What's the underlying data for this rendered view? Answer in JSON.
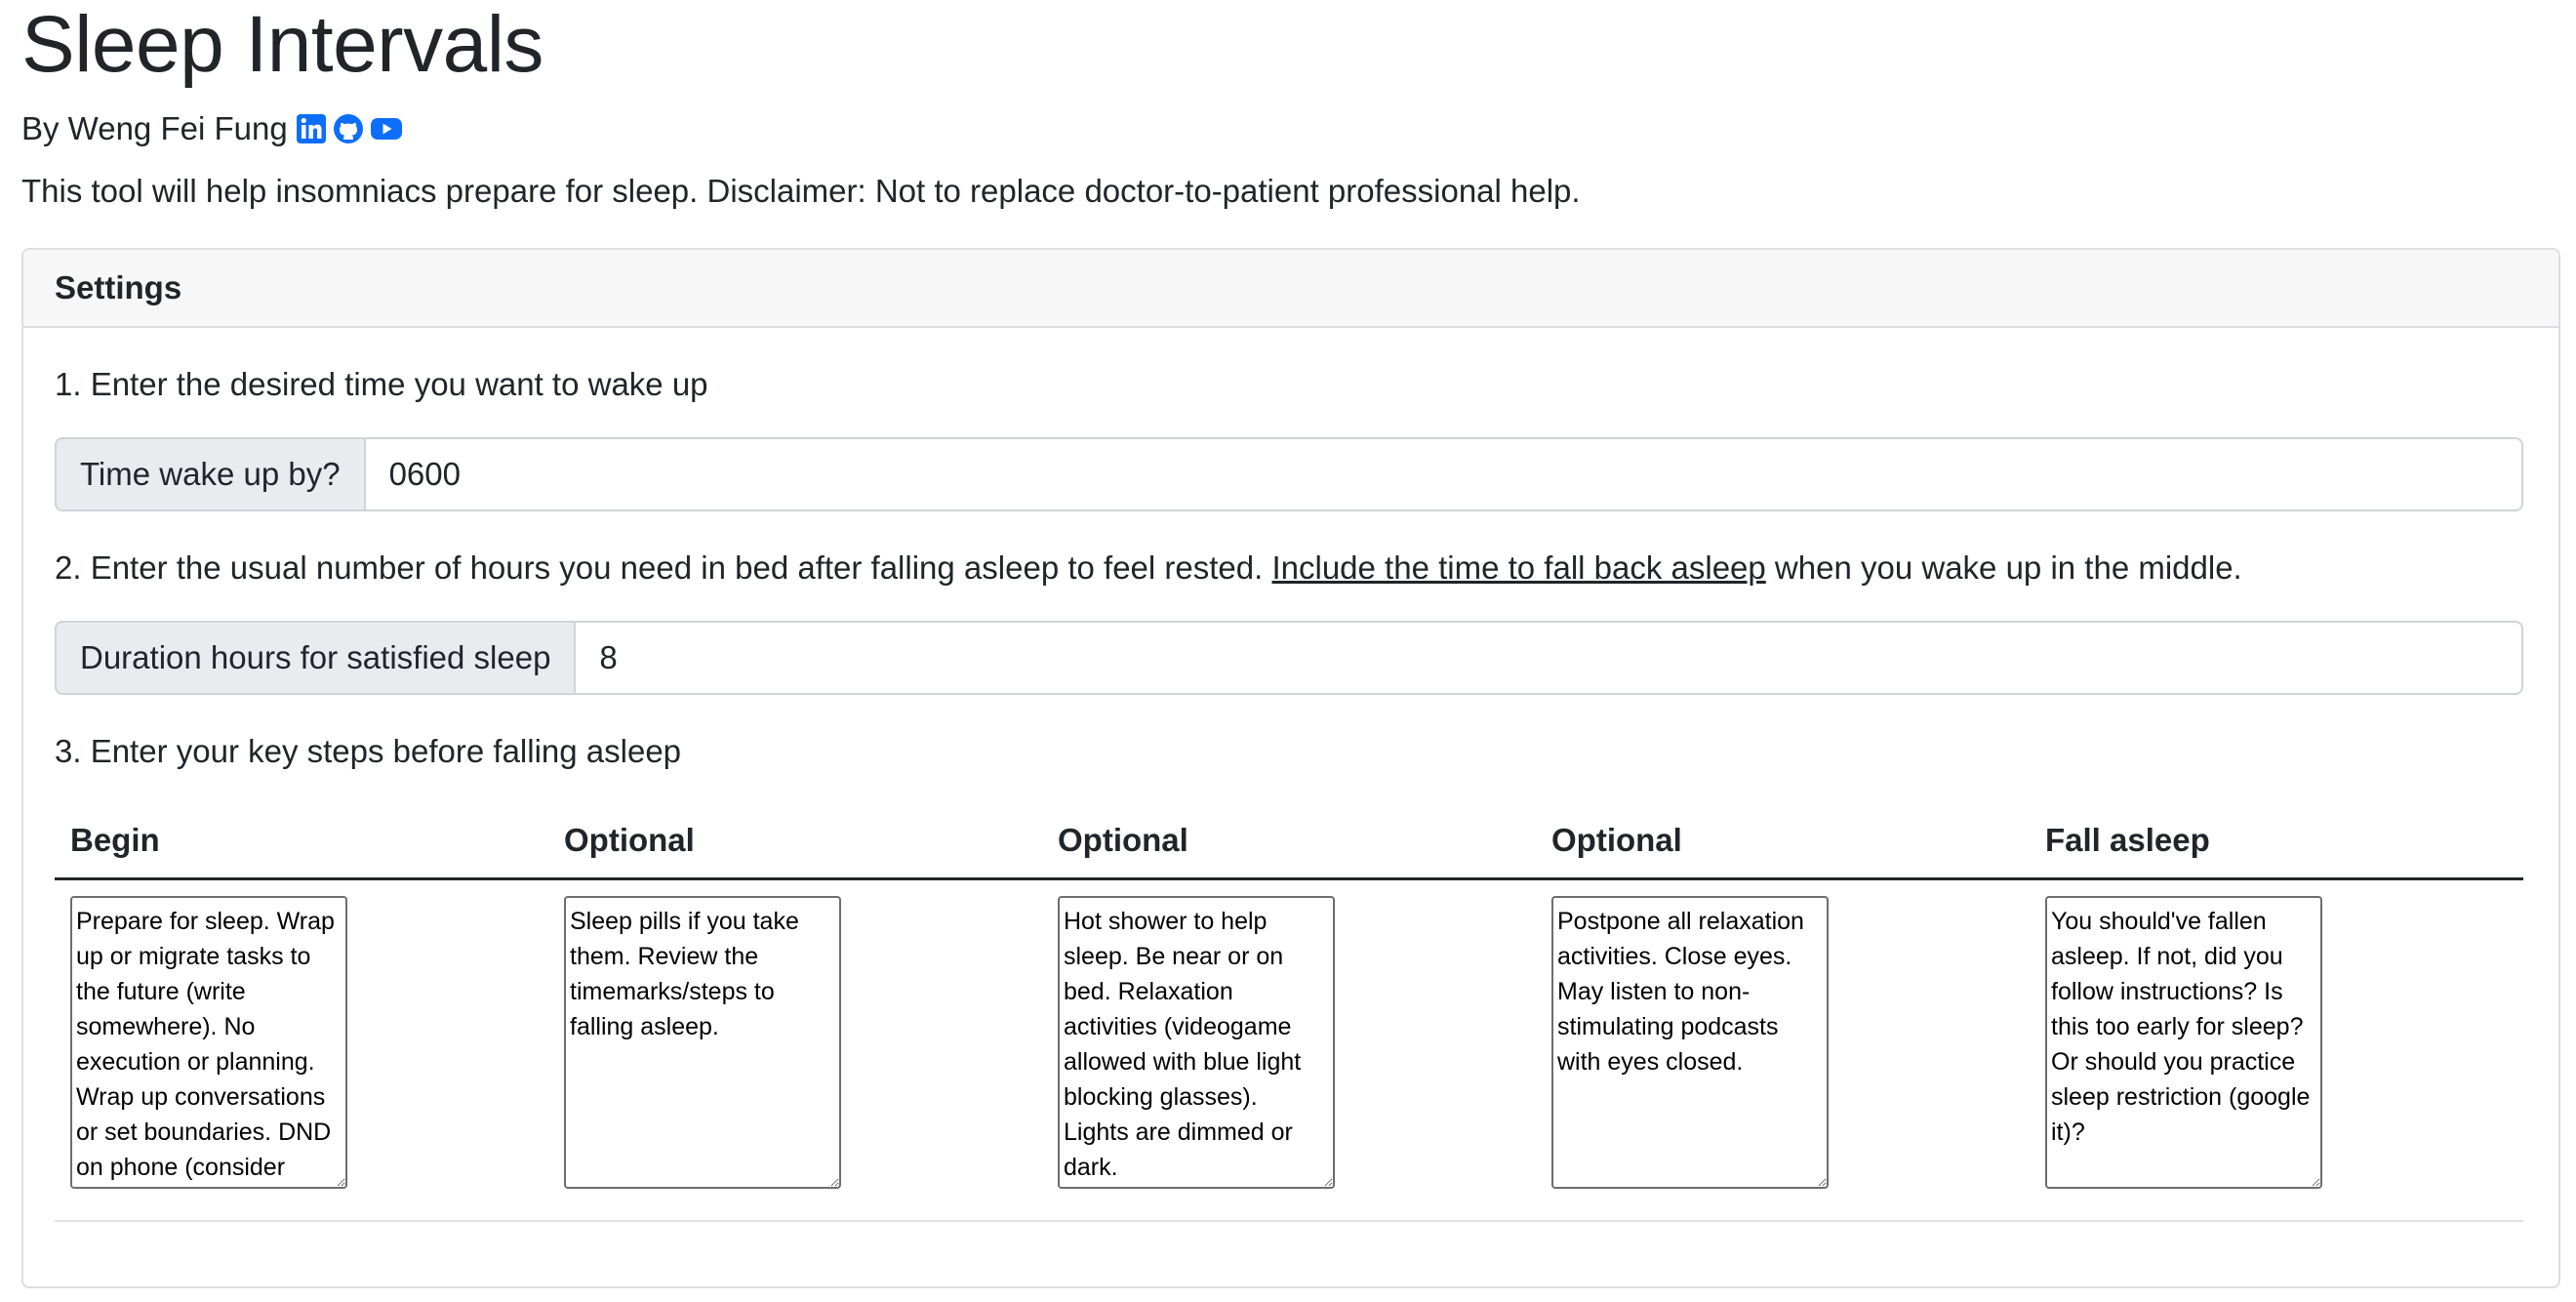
{
  "header": {
    "title": "Sleep Intervals",
    "byline": "By Weng Fei Fung",
    "intro": "This tool will help insomniacs prepare for sleep. Disclaimer: Not to replace doctor-to-patient professional help."
  },
  "social_icons": [
    {
      "name": "linkedin-icon",
      "color": "#0d6efd"
    },
    {
      "name": "github-icon",
      "color": "#0d6efd"
    },
    {
      "name": "youtube-icon",
      "color": "#0d6efd"
    }
  ],
  "settings": {
    "header": "Settings",
    "step1": {
      "label": "1. Enter the desired time you want to wake up",
      "addon": "Time wake up by?",
      "value": "0600"
    },
    "step2": {
      "label_before": "2. Enter the usual number of hours you need in bed after falling asleep to feel rested. ",
      "link": "Include the time to fall back asleep",
      "label_after": " when you wake up in the middle.",
      "addon": "Duration hours for satisfied sleep",
      "value": "8"
    },
    "step3": {
      "label": "3. Enter your key steps before falling asleep"
    }
  },
  "steps_table": {
    "columns": [
      "Begin",
      "Optional",
      "Optional",
      "Optional",
      "Fall asleep"
    ],
    "values": [
      "Prepare for sleep. Wrap up or migrate tasks to the future (write somewhere). No execution or planning. Wrap up conversations or set boundaries. DND on phone (consider",
      "Sleep pills if you take them. Review the timemarks/steps to falling asleep.",
      "Hot shower to help sleep. Be near or on bed. Relaxation activities (videogame allowed with blue light blocking glasses). Lights are dimmed or dark.",
      "Postpone all relaxation activities. Close eyes. May listen to non-stimulating podcasts with eyes closed.",
      "You should've fallen asleep. If not, did you follow instructions? Is this too early for sleep? Or should you practice sleep restriction (google it)?"
    ]
  }
}
